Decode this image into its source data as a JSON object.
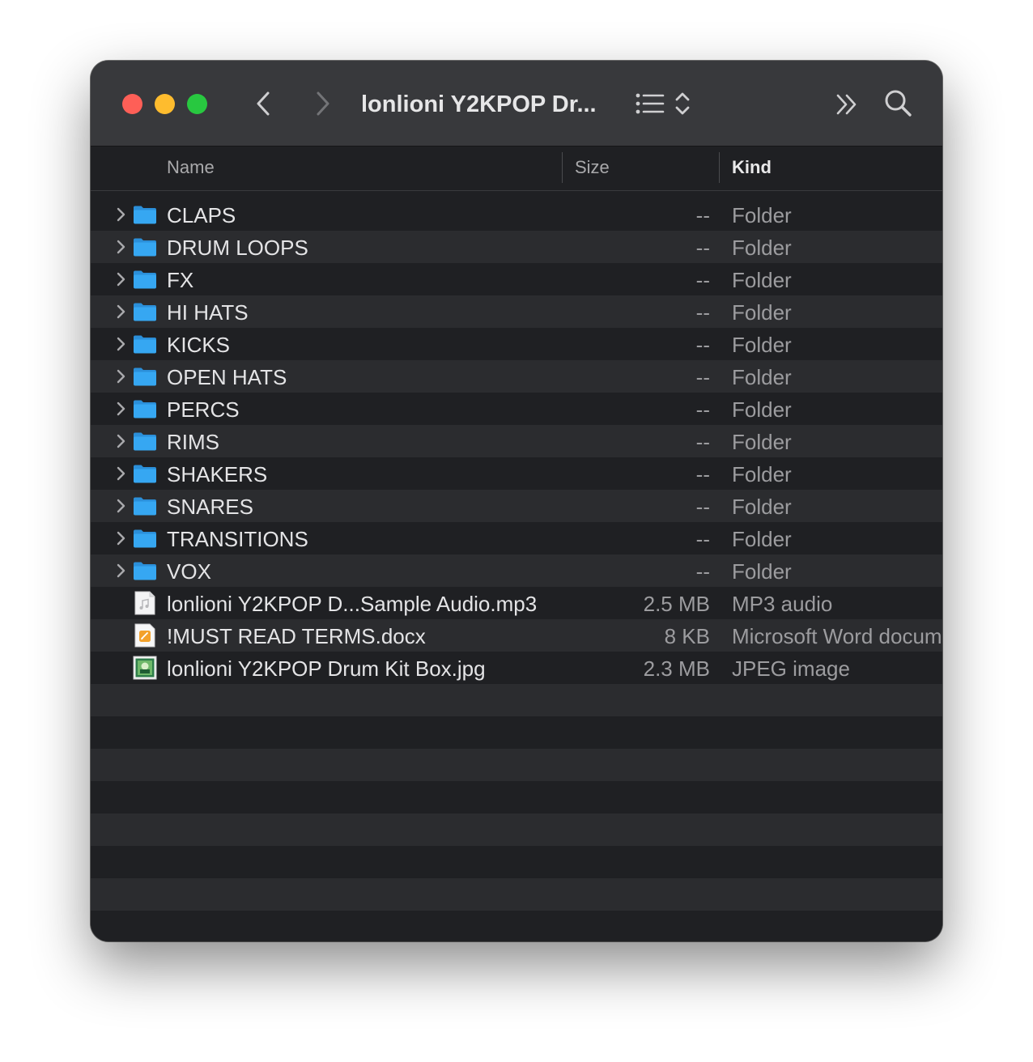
{
  "window": {
    "title": "lonlioni Y2KPOP Dr...",
    "buttons": [
      "close",
      "minimize",
      "zoom"
    ]
  },
  "toolbar": {
    "icons": [
      "back-chevron-icon",
      "forward-chevron-icon",
      "list-view-icon",
      "view-sort-icon",
      "more-chevrons-icon",
      "search-icon"
    ]
  },
  "columns": {
    "name": "Name",
    "size": "Size",
    "kind": "Kind"
  },
  "colors": {
    "folder_blue": "#36a7f2",
    "toolbar_bg": "#38393c",
    "row_bg": "#1f2023",
    "row_alt_bg": "#2b2c2f"
  },
  "items": [
    {
      "name": "CLAPS",
      "size": "--",
      "kind": "Folder",
      "type": "folder"
    },
    {
      "name": "DRUM LOOPS",
      "size": "--",
      "kind": "Folder",
      "type": "folder"
    },
    {
      "name": "FX",
      "size": "--",
      "kind": "Folder",
      "type": "folder"
    },
    {
      "name": "HI HATS",
      "size": "--",
      "kind": "Folder",
      "type": "folder"
    },
    {
      "name": "KICKS",
      "size": "--",
      "kind": "Folder",
      "type": "folder"
    },
    {
      "name": "OPEN HATS",
      "size": "--",
      "kind": "Folder",
      "type": "folder"
    },
    {
      "name": "PERCS",
      "size": "--",
      "kind": "Folder",
      "type": "folder"
    },
    {
      "name": "RIMS",
      "size": "--",
      "kind": "Folder",
      "type": "folder"
    },
    {
      "name": "SHAKERS",
      "size": "--",
      "kind": "Folder",
      "type": "folder"
    },
    {
      "name": "SNARES",
      "size": "--",
      "kind": "Folder",
      "type": "folder"
    },
    {
      "name": "TRANSITIONS",
      "size": "--",
      "kind": "Folder",
      "type": "folder"
    },
    {
      "name": "VOX",
      "size": "--",
      "kind": "Folder",
      "type": "folder"
    },
    {
      "name": "lonlioni Y2KPOP D...Sample Audio.mp3",
      "size": "2.5 MB",
      "kind": "MP3 audio",
      "type": "audio"
    },
    {
      "name": "!MUST READ TERMS.docx",
      "size": "8 KB",
      "kind": "Microsoft Word document",
      "type": "doc"
    },
    {
      "name": "lonlioni Y2KPOP Drum Kit Box.jpg",
      "size": "2.3 MB",
      "kind": "JPEG image",
      "type": "image"
    }
  ]
}
